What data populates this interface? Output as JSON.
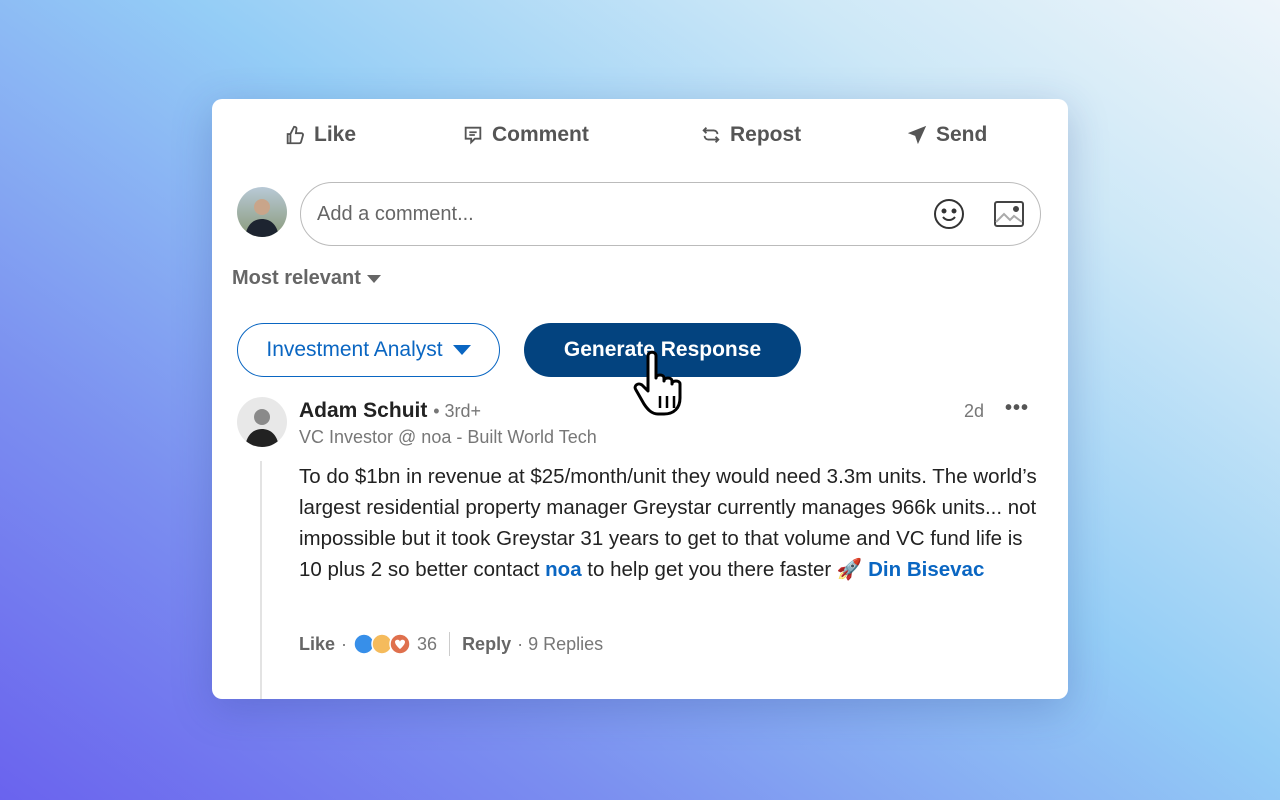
{
  "actions": [
    {
      "label": "Like",
      "icon": "thumbs-up-icon"
    },
    {
      "label": "Comment",
      "icon": "comment-icon"
    },
    {
      "label": "Repost",
      "icon": "repost-icon"
    },
    {
      "label": "Send",
      "icon": "send-icon"
    }
  ],
  "comment_box": {
    "placeholder": "Add a comment..."
  },
  "sort": {
    "label": "Most relevant"
  },
  "role_select": {
    "value": "Investment Analyst"
  },
  "generate_button": {
    "label": "Generate Response"
  },
  "comment": {
    "author": "Adam Schuit",
    "degree": "• 3rd+",
    "headline": "VC Investor @ noa - Built World Tech",
    "time": "2d",
    "text_1": "To do $1bn in revenue at $25/month/unit they would need 3.3m units. The world’s largest residential property manager Greystar currently manages 966k units... not impossible but it took Greystar 31 years to get to that volume and VC fund life is 10 plus 2 so better contact ",
    "mention_1": "noa",
    "text_2": " to help get you there faster ",
    "emoji": "🚀",
    "mention_2": "Din Bisevac",
    "like_label": "Like",
    "dot": "·",
    "reaction_count": "36",
    "reply_label": "Reply",
    "replies": "· 9 Replies"
  },
  "colors": {
    "accent": "#0a66c2",
    "button": "#03437f"
  }
}
